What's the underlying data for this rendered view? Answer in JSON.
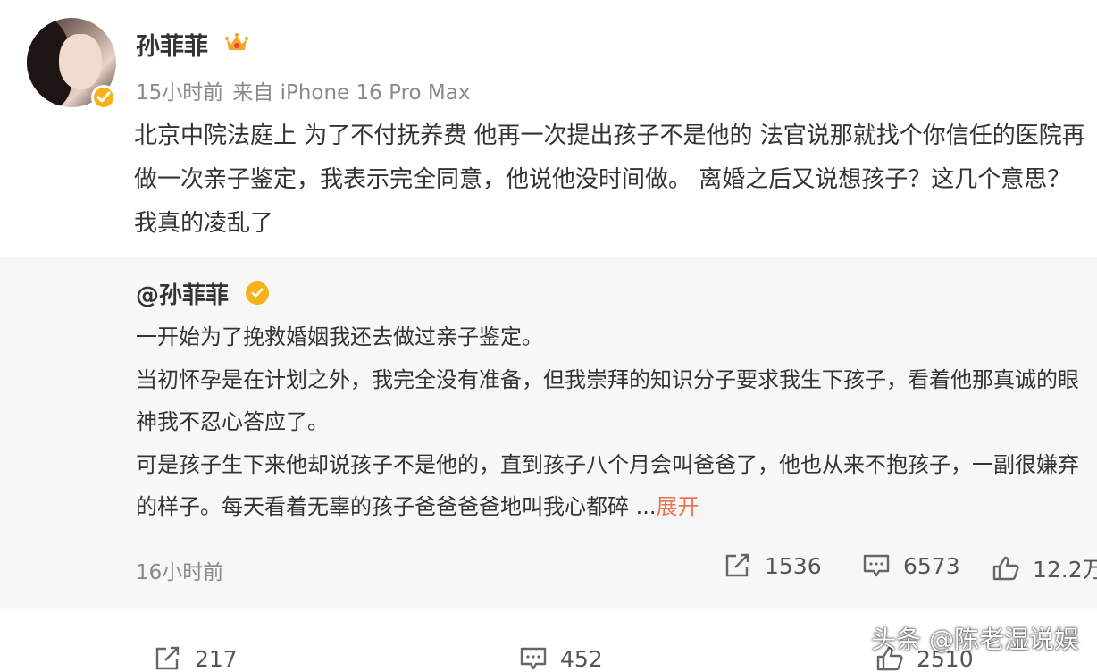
{
  "post": {
    "username": "孙菲菲",
    "time": "15小时前",
    "source": "来自 iPhone 16 Pro Max",
    "content": "北京中院法庭上 为了不付抚养费 他再一次提出孩子不是他的 法官说那就找个你信任的医院再做一次亲子鉴定，我表示完全同意，他说他没时间做。 离婚之后又说想孩子？这几个意思？我真的凌乱了"
  },
  "repost": {
    "username": "@孙菲菲",
    "paragraphs": [
      "一开始为了挽救婚姻我还去做过亲子鉴定。",
      "当初怀孕是在计划之外，我完全没有准备，但我崇拜的知识分子要求我生下孩子，看着他那真诚的眼神我不忍心答应了。"
    ],
    "last_paragraph": "可是孩子生下来他却说孩子不是他的，直到孩子八个月会叫爸爸了，他也从来不抱孩子，一副很嫌弃的样子。每天看着无辜的孩子爸爸爸爸地叫我心都碎 ...",
    "expand_label": "展开",
    "time": "16小时前",
    "stats": {
      "reposts": "1536",
      "comments": "6573",
      "likes": "12.2万"
    }
  },
  "post_stats": {
    "reposts": "217",
    "comments": "452",
    "likes": "2510"
  },
  "watermark": "头条 @陈老湿说娱",
  "colors": {
    "accent": "#eb7350",
    "badge": "#f6b21b",
    "repost_bg": "#f7f7f7"
  }
}
